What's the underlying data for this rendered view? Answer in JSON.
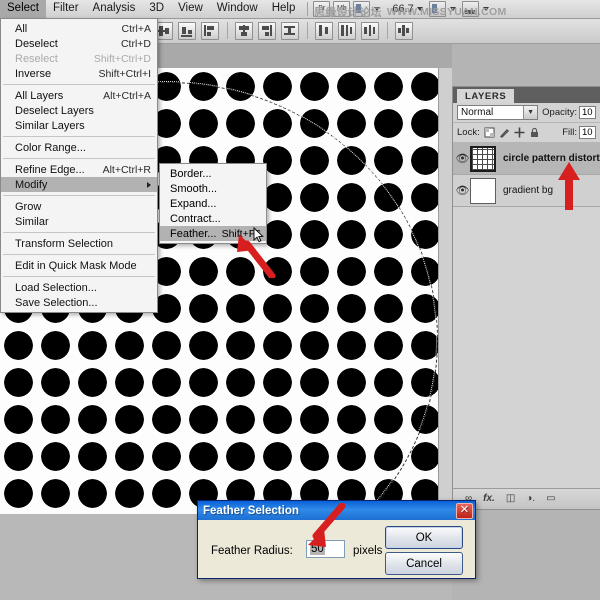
{
  "app": {
    "zoom_level": "66.7",
    "watermark_cn": "思缘设计论坛",
    "watermark_url": "WWW.MISSYUAN.COM"
  },
  "menubar": {
    "items": [
      {
        "label": "Select",
        "active": true
      },
      {
        "label": "Filter",
        "active": false
      },
      {
        "label": "Analysis",
        "active": false
      },
      {
        "label": "3D",
        "active": false
      },
      {
        "label": "View",
        "active": false
      },
      {
        "label": "Window",
        "active": false
      },
      {
        "label": "Help",
        "active": false
      }
    ],
    "bridge_label": "Br",
    "minibridge_label": "Mb",
    "arrange_icon": "arrange-documents-icon",
    "screenmode_icon": "screen-mode-icon"
  },
  "select_menu": {
    "items": [
      {
        "label": "All",
        "accel": "Ctrl+A",
        "kind": "item"
      },
      {
        "label": "Deselect",
        "accel": "Ctrl+D",
        "kind": "item"
      },
      {
        "label": "Reselect",
        "accel": "Shift+Ctrl+D",
        "kind": "disabled"
      },
      {
        "label": "Inverse",
        "accel": "Shift+Ctrl+I",
        "kind": "item"
      },
      {
        "kind": "sep"
      },
      {
        "label": "All Layers",
        "accel": "Alt+Ctrl+A",
        "kind": "item"
      },
      {
        "label": "Deselect Layers",
        "accel": "",
        "kind": "item"
      },
      {
        "label": "Similar Layers",
        "accel": "",
        "kind": "item"
      },
      {
        "kind": "sep"
      },
      {
        "label": "Color Range...",
        "accel": "",
        "kind": "item"
      },
      {
        "kind": "sep"
      },
      {
        "label": "Refine Edge...",
        "accel": "Alt+Ctrl+R",
        "kind": "item"
      },
      {
        "label": "Modify",
        "accel": "",
        "kind": "submenu"
      },
      {
        "kind": "sep"
      },
      {
        "label": "Grow",
        "accel": "",
        "kind": "item"
      },
      {
        "label": "Similar",
        "accel": "",
        "kind": "item"
      },
      {
        "kind": "sep"
      },
      {
        "label": "Transform Selection",
        "accel": "",
        "kind": "item"
      },
      {
        "kind": "sep"
      },
      {
        "label": "Edit in Quick Mask Mode",
        "accel": "",
        "kind": "item"
      },
      {
        "kind": "sep"
      },
      {
        "label": "Load Selection...",
        "accel": "",
        "kind": "item"
      },
      {
        "label": "Save Selection...",
        "accel": "",
        "kind": "item"
      }
    ]
  },
  "modify_submenu": {
    "items": [
      {
        "label": "Border...",
        "accel": "",
        "highlighted": false
      },
      {
        "label": "Smooth...",
        "accel": "",
        "highlighted": false
      },
      {
        "label": "Expand...",
        "accel": "",
        "highlighted": false
      },
      {
        "label": "Contract...",
        "accel": "",
        "highlighted": false
      },
      {
        "label": "Feather...",
        "accel": "Shift+F6",
        "highlighted": true
      }
    ]
  },
  "layers_panel": {
    "tab_label": "LAYERS",
    "blend_mode": "Normal",
    "opacity_label": "Opacity:",
    "opacity_value": "10",
    "lock_label": "Lock:",
    "fill_label": "Fill:",
    "fill_value": "10",
    "lock_icons": [
      "lock-transparent-pixels-icon",
      "lock-image-pixels-icon",
      "lock-position-icon",
      "lock-all-icon"
    ],
    "layers": [
      {
        "name": "circle pattern distort",
        "selected": true,
        "visible": true,
        "thumb": "pattern"
      },
      {
        "name": "gradient bg",
        "selected": false,
        "visible": true,
        "thumb": "white"
      }
    ],
    "footer_icons": [
      "link-layers-icon",
      "add-layer-style-icon",
      "add-layer-mask-icon",
      "new-adjustment-layer-icon",
      "new-group-icon"
    ]
  },
  "options_bar": {
    "align_icons": [
      "align-top-edges-icon",
      "align-vertical-centers-icon",
      "align-bottom-edges-icon",
      "align-left-edges-icon",
      "align-horizontal-centers-icon",
      "align-right-edges-icon",
      "distribute-top-icon",
      "distribute-vertical-center-icon",
      "distribute-bottom-icon",
      "distribute-left-icon"
    ]
  },
  "feather_dialog": {
    "title": "Feather Selection",
    "radius_label": "Feather Radius:",
    "radius_value": "50",
    "units": "pixels",
    "ok_label": "OK",
    "cancel_label": "Cancel",
    "close_glyph": "✕"
  },
  "colors": {
    "selection_highlight": "#b2b2b2",
    "titlebar_blue": "#1d6fd4",
    "annotation_red": "#d81f1f",
    "dot_black": "#000000",
    "canvas_white": "#fdfdfd"
  }
}
